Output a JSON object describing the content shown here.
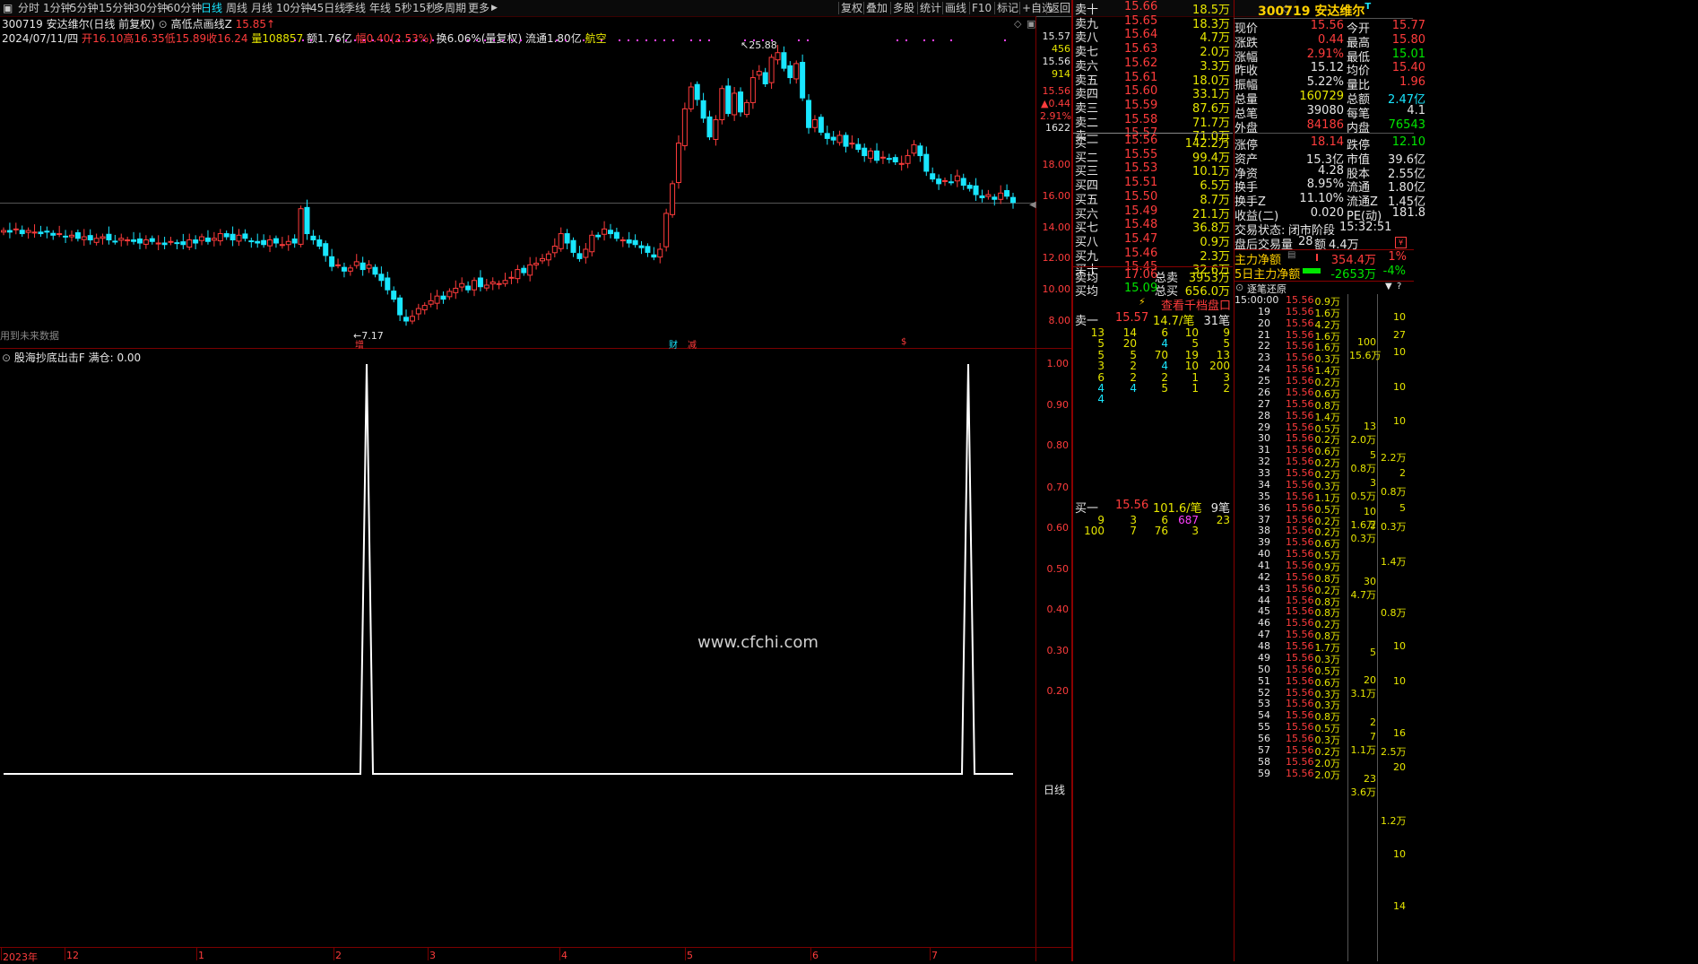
{
  "toolbar": {
    "periods": [
      "分时",
      "1分钟",
      "5分钟",
      "15分钟",
      "30分钟",
      "60分钟",
      "日线",
      "周线",
      "月线",
      "10分钟",
      "45日线",
      "季线",
      "年线",
      "5秒",
      "15秒",
      "多周期",
      "更多"
    ],
    "active_period": "日线",
    "actions": [
      "复权",
      "叠加",
      "多股",
      "统计",
      "画线",
      "F10",
      "标记",
      "+自选",
      "返回"
    ]
  },
  "stock": {
    "code": "300719",
    "name": "安达维尔",
    "title_suffix": "(日线 前复权)",
    "indicator_main": "高低点画线Z",
    "indicator_value": "15.85",
    "date": "2024/07/11/四",
    "open_lbl": "开",
    "open": "16.10",
    "high_lbl": "高",
    "high": "16.35",
    "low_lbl": "低",
    "low": "15.89",
    "close_lbl": "收",
    "close": "16.24",
    "vol_lbl": "量",
    "vol": "108857",
    "amt": "额1.76亿",
    "chg": "幅0.40(2.53%)",
    "turn": "换6.06%(量复权)",
    "float": "流通1.80亿",
    "sector": "航空"
  },
  "main_chart": {
    "right_labels": [
      {
        "t": "15.57",
        "c": "#e6e6e6",
        "y": 41
      },
      {
        "t": "456",
        "c": "#e6e600",
        "y": 55
      },
      {
        "t": "15.56",
        "c": "#e6e6e6",
        "y": 69
      },
      {
        "t": "914",
        "c": "#e6e600",
        "y": 83
      },
      {
        "t": "15.56",
        "c": "#ff3c3c",
        "y": 102
      },
      {
        "t": "▲0.44",
        "c": "#ff3c3c",
        "y": 116
      },
      {
        "t": "2.91%",
        "c": "#ff3c3c",
        "y": 130
      },
      {
        "t": "1622",
        "c": "#e6e6e6",
        "y": 143
      }
    ],
    "y_ticks": [
      "18.00",
      "16.00",
      "14.00",
      "12.00",
      "10.00",
      "8.00"
    ],
    "high_mark": "25.88",
    "low_mark": "7.17",
    "future_note": "用到未来数据",
    "event_marks": [
      {
        "t": "增",
        "c": "#ff3c3c"
      },
      {
        "t": "财",
        "c": "#19e6ff"
      },
      {
        "t": "减",
        "c": "#ff3c3c"
      },
      {
        "t": "$",
        "c": "#ff3c3c"
      }
    ]
  },
  "sub_chart": {
    "title": "股海抄底出击F 满仓: 0.00",
    "y_ticks": [
      "1.00",
      "0.90",
      "0.80",
      "0.70",
      "0.60",
      "0.50",
      "0.40",
      "0.30",
      "0.20"
    ],
    "watermark": "www.cfchi.com",
    "period_label": "日线"
  },
  "x_axis": [
    "2023年",
    "12",
    "1",
    "2",
    "3",
    "4",
    "5",
    "6",
    "7"
  ],
  "order_book": {
    "asks": [
      {
        "lbl": "卖十",
        "p": "15.66",
        "v": "18.5万"
      },
      {
        "lbl": "卖九",
        "p": "15.65",
        "v": "18.3万"
      },
      {
        "lbl": "卖八",
        "p": "15.64",
        "v": "4.7万"
      },
      {
        "lbl": "卖七",
        "p": "15.63",
        "v": "2.0万"
      },
      {
        "lbl": "卖六",
        "p": "15.62",
        "v": "3.3万"
      },
      {
        "lbl": "卖五",
        "p": "15.61",
        "v": "18.0万"
      },
      {
        "lbl": "卖四",
        "p": "15.60",
        "v": "33.1万"
      },
      {
        "lbl": "卖三",
        "p": "15.59",
        "v": "87.6万"
      },
      {
        "lbl": "卖二",
        "p": "15.58",
        "v": "71.7万"
      },
      {
        "lbl": "卖一",
        "p": "15.57",
        "v": "71.0万"
      }
    ],
    "bids": [
      {
        "lbl": "买一",
        "p": "15.56",
        "v": "142.2万"
      },
      {
        "lbl": "买二",
        "p": "15.55",
        "v": "99.4万"
      },
      {
        "lbl": "买三",
        "p": "15.53",
        "v": "10.1万"
      },
      {
        "lbl": "买四",
        "p": "15.51",
        "v": "6.5万"
      },
      {
        "lbl": "买五",
        "p": "15.50",
        "v": "8.7万"
      },
      {
        "lbl": "买六",
        "p": "15.49",
        "v": "21.1万"
      },
      {
        "lbl": "买七",
        "p": "15.48",
        "v": "36.8万"
      },
      {
        "lbl": "买八",
        "p": "15.47",
        "v": "0.9万"
      },
      {
        "lbl": "买九",
        "p": "15.46",
        "v": "2.3万"
      },
      {
        "lbl": "买十",
        "p": "15.45",
        "v": "32.6万"
      }
    ],
    "sell_avg_lbl": "卖均",
    "sell_avg": "17.06",
    "total_sell_lbl": "总卖",
    "total_sell": "3953万",
    "buy_avg_lbl": "买均",
    "buy_avg": "15.09",
    "total_buy_lbl": "总买",
    "total_buy": "656.0万",
    "thousand_btn": "查看千档盘口"
  },
  "queue": {
    "sell1": {
      "lbl": "卖一",
      "p": "15.57",
      "avg": "14.7/笔",
      "cnt": "31笔",
      "rows": [
        [
          "13",
          "14",
          "6",
          "10",
          "9"
        ],
        [
          "5",
          "20",
          "4",
          "5",
          "5"
        ],
        [
          "5",
          "5",
          "70",
          "19",
          "13"
        ],
        [
          "3",
          "2",
          "4",
          "10",
          "200"
        ],
        [
          "6",
          "2",
          "2",
          "1",
          "3"
        ],
        [
          "4",
          "4",
          "5",
          "1",
          "2"
        ],
        [
          "4",
          "",
          "",
          "",
          ""
        ]
      ]
    },
    "buy1": {
      "lbl": "买一",
      "p": "15.56",
      "avg": "101.6/笔",
      "cnt": "9笔",
      "rows": [
        [
          "9",
          "3",
          "6",
          "687",
          "23"
        ],
        [
          "100",
          "7",
          "76",
          "3",
          ""
        ]
      ]
    }
  },
  "quote": {
    "code": "300719",
    "name": "安达维尔",
    "rows": [
      [
        "现价",
        "15.56",
        "今开",
        "15.77"
      ],
      [
        "涨跌",
        "0.44",
        "最高",
        "15.80"
      ],
      [
        "涨幅",
        "2.91%",
        "最低",
        "15.01"
      ],
      [
        "昨收",
        "15.12",
        "均价",
        "15.40"
      ],
      [
        "振幅",
        "5.22%",
        "量比",
        "1.96"
      ],
      [
        "总量",
        "160729",
        "总额",
        "2.47亿"
      ],
      [
        "总笔",
        "39080",
        "每笔",
        "4.1"
      ],
      [
        "外盘",
        "84186",
        "内盘",
        "76543"
      ],
      [
        "涨停",
        "18.14",
        "跌停",
        "12.10"
      ],
      [
        "资产",
        "15.3亿",
        "市值",
        "39.6亿"
      ],
      [
        "净资",
        "4.28",
        "股本",
        "2.55亿"
      ],
      [
        "换手",
        "8.95%",
        "流通",
        "1.80亿"
      ],
      [
        "换手Z",
        "11.10%",
        "流通Z",
        "1.45亿"
      ],
      [
        "收益(二)",
        "0.020",
        "PE(动)",
        "181.8"
      ]
    ],
    "trade_state_lbl": "交易状态:",
    "trade_state": "闭市阶段",
    "trade_time": "15:32:51",
    "after_lbl": "盘后交易量",
    "after_vol": "28",
    "after_amt_lbl": "额",
    "after_amt": "4.4万",
    "main_net_lbl": "主力净额",
    "main_net": "354.4万",
    "main_net_pct": "1%",
    "main5_lbl": "5日主力净额",
    "main5": "-2653万",
    "main5_pct": "-4%"
  },
  "tick_panel": {
    "title": "逐笔还原",
    "ticks": [
      [
        "15:00:00",
        "15.56",
        "0.9万"
      ],
      [
        "19",
        "15.56",
        "1.6万"
      ],
      [
        "20",
        "15.56",
        "4.2万"
      ],
      [
        "21",
        "15.56",
        "1.6万"
      ],
      [
        "22",
        "15.56",
        "1.6万"
      ],
      [
        "23",
        "15.56",
        "0.3万"
      ],
      [
        "24",
        "15.56",
        "1.4万"
      ],
      [
        "25",
        "15.56",
        "0.2万"
      ],
      [
        "26",
        "15.56",
        "0.6万"
      ],
      [
        "27",
        "15.56",
        "0.8万"
      ],
      [
        "28",
        "15.56",
        "1.4万"
      ],
      [
        "29",
        "15.56",
        "0.5万"
      ],
      [
        "30",
        "15.56",
        "0.2万"
      ],
      [
        "31",
        "15.56",
        "0.6万"
      ],
      [
        "32",
        "15.56",
        "0.2万"
      ],
      [
        "33",
        "15.56",
        "0.2万"
      ],
      [
        "34",
        "15.56",
        "0.3万"
      ],
      [
        "35",
        "15.56",
        "1.1万"
      ],
      [
        "36",
        "15.56",
        "0.5万"
      ],
      [
        "37",
        "15.56",
        "0.2万"
      ],
      [
        "38",
        "15.56",
        "0.2万"
      ],
      [
        "39",
        "15.56",
        "0.6万"
      ],
      [
        "40",
        "15.56",
        "0.5万"
      ],
      [
        "41",
        "15.56",
        "0.9万"
      ],
      [
        "42",
        "15.56",
        "0.8万"
      ],
      [
        "43",
        "15.56",
        "0.2万"
      ],
      [
        "44",
        "15.56",
        "0.8万"
      ],
      [
        "45",
        "15.56",
        "0.8万"
      ],
      [
        "46",
        "15.56",
        "0.2万"
      ],
      [
        "47",
        "15.56",
        "0.8万"
      ],
      [
        "48",
        "15.56",
        "1.7万"
      ],
      [
        "49",
        "15.56",
        "0.3万"
      ],
      [
        "50",
        "15.56",
        "0.5万"
      ],
      [
        "51",
        "15.56",
        "0.6万"
      ],
      [
        "52",
        "15.56",
        "0.3万"
      ],
      [
        "53",
        "15.56",
        "0.3万"
      ],
      [
        "54",
        "15.56",
        "0.8万"
      ],
      [
        "55",
        "15.56",
        "0.5万"
      ],
      [
        "56",
        "15.56",
        "0.3万"
      ],
      [
        "57",
        "15.56",
        "0.2万"
      ],
      [
        "58",
        "15.56",
        "2.0万"
      ],
      [
        "59",
        "15.56",
        "2.0万"
      ]
    ],
    "agg": [
      {
        "a": "100",
        "b": "15.6万",
        "row": 3
      },
      {
        "a": "13",
        "b": "2.0万",
        "row": 9
      },
      {
        "a": "5",
        "b": "0.8万",
        "row": 11
      },
      {
        "a": "3",
        "b": "0.5万",
        "row": 13
      },
      {
        "a": "10",
        "b": "1.6万",
        "row": 15
      },
      {
        "a": "2",
        "b": "0.3万",
        "row": 16
      },
      {
        "a": "30",
        "b": "4.7万",
        "row": 20
      },
      {
        "a": "5",
        "b": "",
        "row": 25
      },
      {
        "a": "20",
        "b": "3.1万",
        "row": 27
      },
      {
        "a": "2",
        "b": "",
        "row": 30
      },
      {
        "a": "7",
        "b": "1.1万",
        "row": 31
      },
      {
        "a": "23",
        "b": "3.6万",
        "row": 34
      }
    ],
    "side": [
      {
        "t": "10",
        "row": 1
      },
      {
        "t": "27",
        "row": 2
      },
      {
        "t": "10",
        "row": 3
      },
      {
        "t": "10",
        "row": 5
      },
      {
        "t": "10",
        "row": 7
      },
      {
        "t": "2.2万",
        "row": 9
      },
      {
        "t": "2",
        "row": 10
      },
      {
        "t": "0.8万",
        "row": 11
      },
      {
        "t": "5",
        "row": 12
      },
      {
        "t": "0.3万",
        "row": 13
      },
      {
        "t": "1.4万",
        "row": 15
      },
      {
        "t": "0.8万",
        "row": 18
      },
      {
        "t": "10",
        "row": 20
      },
      {
        "t": "10",
        "row": 22
      },
      {
        "t": "16",
        "row": 25
      },
      {
        "t": "2.5万",
        "row": 26
      },
      {
        "t": "20",
        "row": 27
      },
      {
        "t": "1.2万",
        "row": 30
      },
      {
        "t": "10",
        "row": 32
      },
      {
        "t": "14",
        "row": 35
      }
    ]
  }
}
